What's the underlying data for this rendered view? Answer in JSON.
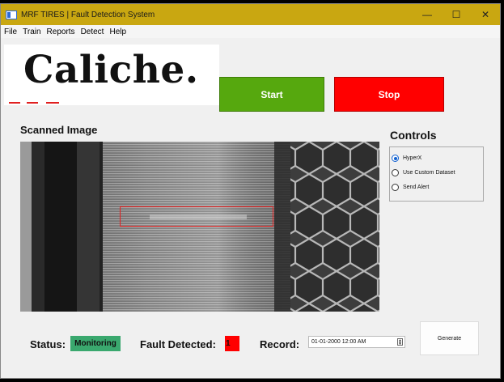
{
  "window": {
    "title": "MRF TIRES | Fault Detection System",
    "minimize": "—",
    "maximize": "☐",
    "close": "✕"
  },
  "menu": [
    "File",
    "Train",
    "Reports",
    "Detect",
    "Help"
  ],
  "logo": {
    "text": "Caliche."
  },
  "buttons": {
    "start": "Start",
    "stop": "Stop",
    "generate": "Generate"
  },
  "scanned": {
    "title": "Scanned Image"
  },
  "controls": {
    "title": "Controls",
    "options": [
      {
        "label": "HyperX",
        "checked": true
      },
      {
        "label": "Use Custom Dataset",
        "checked": false
      },
      {
        "label": "Send Alert",
        "checked": false
      }
    ]
  },
  "status": {
    "label": "Status:",
    "value": "Monitoring"
  },
  "fault": {
    "label": "Fault Detected:",
    "value": "1"
  },
  "record": {
    "label": "Record:",
    "value": "01-01-2000 12:00 AM"
  },
  "colors": {
    "titlebar": "#c9a711",
    "start": "#56a80e",
    "stop": "#ff0000",
    "status": "#3aa86e",
    "fault_box": "#e02020"
  },
  "icons": {
    "app": "window-icon",
    "spinner": "up-down-arrows-icon"
  }
}
